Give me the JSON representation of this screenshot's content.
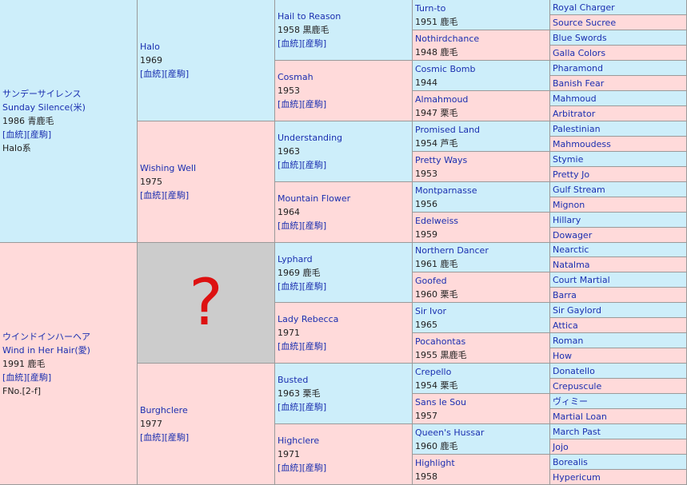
{
  "horses": [
    {
      "id": "h1",
      "name": "サンデーサイレンス",
      "name2": "Sunday Silence(米)",
      "info": "1986 青鹿毛",
      "links": [
        "[血統]",
        "[産駒]"
      ],
      "extra": "Halo系"
    },
    {
      "id": "h2",
      "name": "ウインドインハーヘア",
      "name2": "Wind in Her Hair(愛)",
      "info": "1991 鹿毛",
      "links": [
        "[血統]",
        "[産駒]"
      ],
      "extra": "FNo.[2-f]"
    },
    {
      "id": "h11",
      "name": "Halo",
      "info": "1969",
      "links": [
        "[血統]",
        "[産駒]"
      ]
    },
    {
      "id": "h12",
      "name": "Wishing Well",
      "info": "1975",
      "links": [
        "[血統]",
        "[産駒]"
      ]
    },
    {
      "id": "h13",
      "unknown": "?"
    },
    {
      "id": "h14",
      "name": "Burghclere",
      "info": "1977",
      "links": [
        "[血統]",
        "[産駒]"
      ]
    },
    {
      "id": "h111",
      "name": "Hail to Reason",
      "info": "1958 黒鹿毛",
      "links": [
        "[血統]",
        "[産駒]"
      ]
    },
    {
      "id": "h112",
      "name": "Cosmah",
      "info": "1953",
      "links": [
        "[血統]",
        "[産駒]"
      ]
    },
    {
      "id": "h121",
      "name": "Understanding",
      "info": "1963",
      "links": [
        "[血統]",
        "[産駒]"
      ]
    },
    {
      "id": "h122",
      "name": "Mountain Flower",
      "info": "1964",
      "links": [
        "[血統]",
        "[産駒]"
      ]
    },
    {
      "id": "h131",
      "name": "Lyphard",
      "info": "1969 鹿毛",
      "links": [
        "[血統]",
        "[産駒]"
      ]
    },
    {
      "id": "h132",
      "name": "Lady Rebecca",
      "info": "1971",
      "links": [
        "[血統]",
        "[産駒]"
      ]
    },
    {
      "id": "h141",
      "name": "Busted",
      "info": "1963 栗毛",
      "links": [
        "[血統]",
        "[産駒]"
      ]
    },
    {
      "id": "h142",
      "name": "Highclere",
      "info": "1971",
      "links": [
        "[血統]",
        "[産駒]"
      ]
    },
    {
      "id": "g1",
      "name": "Turn-to",
      "info": "1951 鹿毛"
    },
    {
      "id": "g2",
      "name": "Nothirdchance",
      "info": "1948 鹿毛"
    },
    {
      "id": "g3",
      "name": "Cosmic Bomb",
      "info": "1944"
    },
    {
      "id": "g4",
      "name": "Almahmoud",
      "info": "1947 栗毛"
    },
    {
      "id": "g5",
      "name": "Promised Land",
      "info": "1954 芦毛"
    },
    {
      "id": "g6",
      "name": "Pretty Ways",
      "info": "1953"
    },
    {
      "id": "g7",
      "name": "Montparnasse",
      "info": "1956"
    },
    {
      "id": "g8",
      "name": "Edelweiss",
      "info": "1959"
    },
    {
      "id": "g9",
      "name": "Northern Dancer",
      "info": "1961 鹿毛"
    },
    {
      "id": "g10",
      "name": "Goofed",
      "info": "1960 栗毛"
    },
    {
      "id": "g11",
      "name": "Sir Ivor",
      "info": "1965"
    },
    {
      "id": "g12",
      "name": "Pocahontas",
      "info": "1955 黒鹿毛"
    },
    {
      "id": "g13",
      "name": "Crepello",
      "info": "1954 栗毛"
    },
    {
      "id": "g14",
      "name": "Sans le Sou",
      "info": "1957"
    },
    {
      "id": "g15",
      "name": "Queen's Hussar",
      "info": "1960 鹿毛"
    },
    {
      "id": "g16",
      "name": "Highlight",
      "info": "1958"
    },
    {
      "id": "f1",
      "name": "Royal Charger"
    },
    {
      "id": "f2",
      "name": "Source Sucree"
    },
    {
      "id": "f3",
      "name": "Blue Swords"
    },
    {
      "id": "f4",
      "name": "Galla Colors"
    },
    {
      "id": "f5",
      "name": "Pharamond"
    },
    {
      "id": "f6",
      "name": "Banish Fear"
    },
    {
      "id": "f7",
      "name": "Mahmoud"
    },
    {
      "id": "f8",
      "name": "Arbitrator"
    },
    {
      "id": "f9",
      "name": "Palestinian"
    },
    {
      "id": "f10",
      "name": "Mahmoudess"
    },
    {
      "id": "f11",
      "name": "Stymie"
    },
    {
      "id": "f12",
      "name": "Pretty Jo"
    },
    {
      "id": "f13",
      "name": "Gulf Stream"
    },
    {
      "id": "f14",
      "name": "Mignon"
    },
    {
      "id": "f15",
      "name": "Hillary"
    },
    {
      "id": "f16",
      "name": "Dowager"
    },
    {
      "id": "f17",
      "name": "Nearctic"
    },
    {
      "id": "f18",
      "name": "Natalma"
    },
    {
      "id": "f19",
      "name": "Court Martial"
    },
    {
      "id": "f20",
      "name": "Barra"
    },
    {
      "id": "f21",
      "name": "Sir Gaylord"
    },
    {
      "id": "f22",
      "name": "Attica"
    },
    {
      "id": "f23",
      "name": "Roman"
    },
    {
      "id": "f24",
      "name": "How"
    },
    {
      "id": "f25",
      "name": "Donatello"
    },
    {
      "id": "f26",
      "name": "Crepuscule"
    },
    {
      "id": "f27",
      "name": "ヴィミー"
    },
    {
      "id": "f28",
      "name": "Martial Loan"
    },
    {
      "id": "f29",
      "name": "March Past"
    },
    {
      "id": "f30",
      "name": "Jojo"
    },
    {
      "id": "f31",
      "name": "Borealis"
    },
    {
      "id": "f32",
      "name": "Hypericum"
    }
  ]
}
